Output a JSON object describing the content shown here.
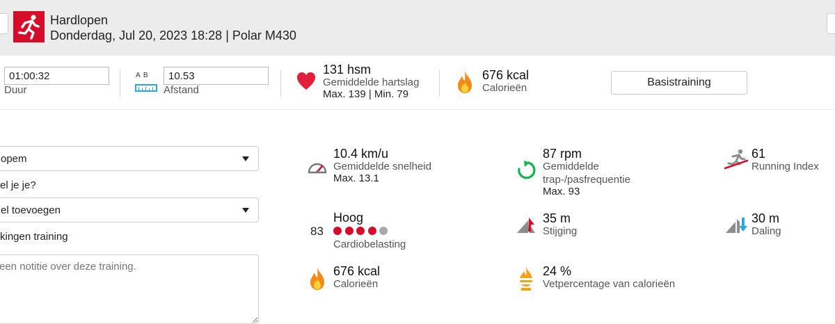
{
  "header": {
    "title": "Hardlopen",
    "subtitle": "Donderdag, Jul 20, 2023 18:28 | Polar M430",
    "sport_icon": "running-person-icon",
    "accent_color": "#d50d2b"
  },
  "summary": {
    "duration": {
      "value": "01:00:32",
      "label": "Duur"
    },
    "distance": {
      "ab_label": "A  B",
      "value": "10.53",
      "label": "Afstand",
      "icon": "ruler-icon"
    },
    "heart_rate": {
      "value": "131 hsm",
      "label": "Gemiddelde hartslag",
      "max_min": "Max. 139  |  Min. 79",
      "icon": "heart-icon"
    },
    "calories": {
      "value": "676 kcal",
      "label": "Calorieën",
      "icon": "flame-icon"
    },
    "basis_button": "Basistraining"
  },
  "form": {
    "sport_select": "opem",
    "question": "el je je?",
    "feeling_select": "el toevoegen",
    "notes_label": "kingen training",
    "notes_placeholder": "een notitie over deze training."
  },
  "metrics": {
    "speed": {
      "value": "10.4 km/u",
      "label": "Gemiddelde snelheid",
      "sub": "Max. 13.1",
      "icon": "speedometer-icon"
    },
    "cadence": {
      "value": "87 rpm",
      "label_1": "Gemiddelde",
      "label_2": "trap-/pasfrequentie",
      "sub": "Max. 93",
      "icon": "cadence-arrow-icon"
    },
    "running_index": {
      "value": "61",
      "label": "Running Index",
      "icon": "running-index-icon"
    },
    "cardio_load": {
      "number": "83",
      "value": "Hoog",
      "label": "Cardiobelasting",
      "filled_dots": 4,
      "total_dots": 5
    },
    "ascent": {
      "value": "35 m",
      "label": "Stijging",
      "icon": "ascent-icon"
    },
    "descent": {
      "value": "30 m",
      "label": "Daling",
      "icon": "descent-icon"
    },
    "calories": {
      "value": "676 kcal",
      "label": "Calorieën",
      "icon": "flame-icon"
    },
    "fat_pct": {
      "value": "24 %",
      "label": "Vetpercentage van calorieën",
      "icon": "fat-burn-icon"
    }
  }
}
